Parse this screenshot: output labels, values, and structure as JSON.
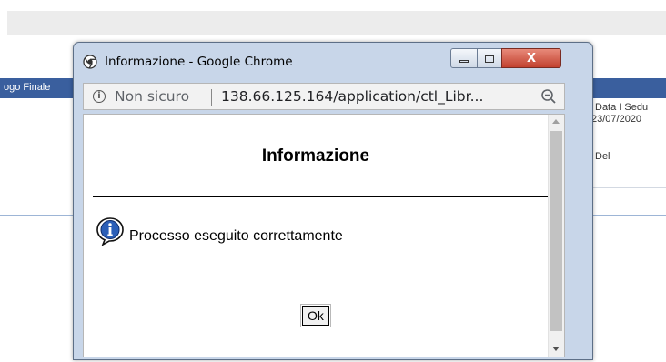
{
  "background": {
    "band_label": "ogo Finale",
    "col_header": "Data I Sedu",
    "col_date": "23/07/2020",
    "col_del": "Del"
  },
  "window": {
    "title": "Informazione - Google Chrome",
    "controls": {
      "close": "X"
    }
  },
  "addressbar": {
    "security_label": "Non sicuro",
    "url": "138.66.125.164/application/ctl_Libr..."
  },
  "dialog": {
    "title": "Informazione",
    "message": "Processo eseguito correttamente",
    "ok_label": "Ok"
  },
  "icons": [
    "chrome-icon",
    "minimize-icon",
    "maximize-icon",
    "close-icon",
    "info-icon",
    "zoom-out-icon",
    "information-bubble-icon"
  ]
}
